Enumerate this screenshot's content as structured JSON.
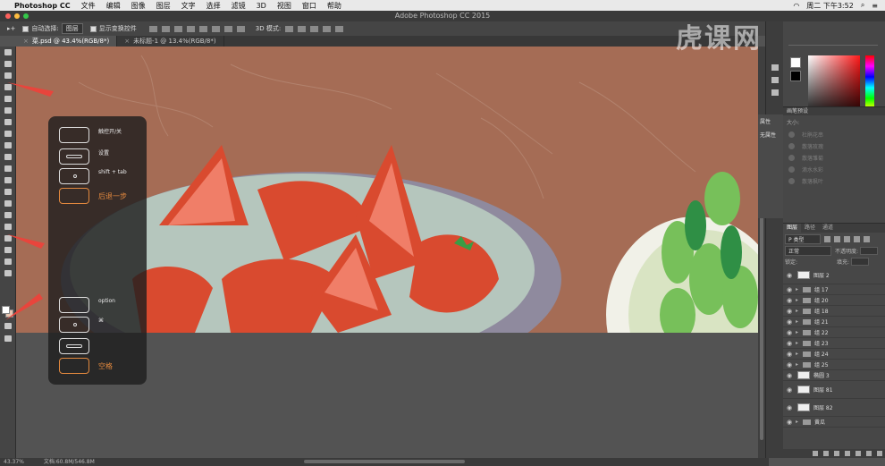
{
  "menubar": {
    "apple": "",
    "app_name": "Photoshop CC",
    "items": [
      "文件",
      "编辑",
      "图像",
      "图层",
      "文字",
      "选择",
      "滤镜",
      "3D",
      "视图",
      "窗口",
      "帮助"
    ],
    "status_right": "周二 下午3:52"
  },
  "window": {
    "title": "Adobe Photoshop CC 2015"
  },
  "options": {
    "auto_select_label": "自动选择:",
    "auto_select_value": "图层",
    "show_transform_label": "显示变换控件",
    "mode_3d_label": "3D 模式:"
  },
  "tabs": [
    {
      "label": "菜.psd @ 43.4%(RGB/8*)",
      "close": "×"
    },
    {
      "label": "未标题-1 @ 13.4%(RGB/8*)",
      "close": "×"
    }
  ],
  "overlay": {
    "rows": [
      {
        "label": "触控开/关",
        "type": "plain"
      },
      {
        "label": "设置",
        "type": "pill"
      },
      {
        "label": "shift + tab",
        "type": "dot"
      },
      {
        "label": "后退一步",
        "type": "orange"
      },
      {
        "label": "option",
        "type": "plain"
      },
      {
        "label": "⌘",
        "type": "dot"
      },
      {
        "label": "",
        "type": "pill"
      },
      {
        "label": "空格",
        "type": "orange"
      }
    ]
  },
  "properties": {
    "tab": "属性",
    "content": "无属性"
  },
  "brush_panel": {
    "title": "画笔预设",
    "size_label": "大小:",
    "items": [
      "杜鹃花串",
      "散落玫瑰",
      "散落雏菊",
      "滴水水彩",
      "散落枫叶"
    ]
  },
  "layers": {
    "tabs": [
      "图层",
      "路径",
      "通道"
    ],
    "filter": "P 类型",
    "blend_mode": "正常",
    "opacity_label": "不透明度:",
    "lock_label": "锁定:",
    "fill_label": "填充:",
    "rows": [
      {
        "name": "图层 2",
        "kind": "thumb"
      },
      {
        "name": "组 17",
        "kind": "group"
      },
      {
        "name": "组 20",
        "kind": "group"
      },
      {
        "name": "组 18",
        "kind": "group"
      },
      {
        "name": "组 21",
        "kind": "group"
      },
      {
        "name": "组 22",
        "kind": "group"
      },
      {
        "name": "组 23",
        "kind": "group"
      },
      {
        "name": "组 24",
        "kind": "group"
      },
      {
        "name": "组 25",
        "kind": "group"
      },
      {
        "name": "椭圆 3",
        "kind": "shape"
      },
      {
        "name": "图层 81",
        "kind": "thumb"
      },
      {
        "name": "图层 82",
        "kind": "thumb"
      },
      {
        "name": "黄瓜",
        "kind": "group"
      }
    ]
  },
  "statusbar": {
    "zoom": "43.37%",
    "doc": "文档:60.8M/546.8M"
  },
  "watermark": "虎课网",
  "colors": {
    "canvas_bg": "#a56c55",
    "accent_orange": "#e3893e",
    "arrow_red": "#e8453c"
  }
}
